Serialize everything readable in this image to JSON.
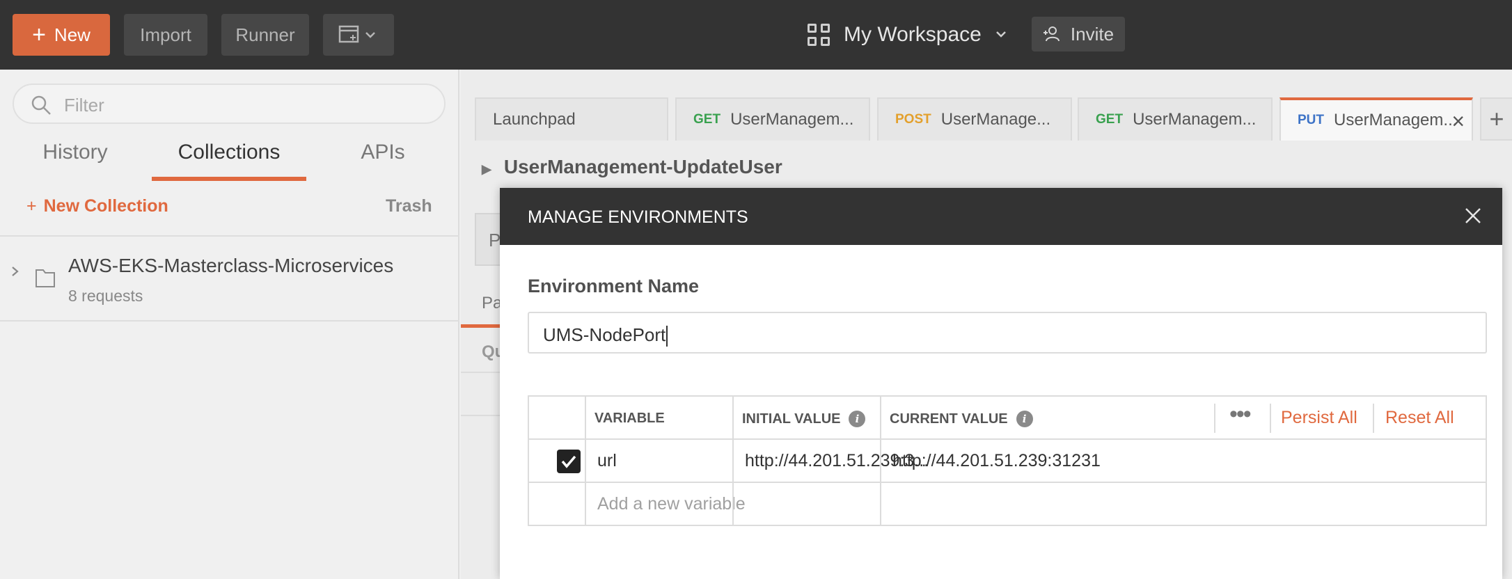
{
  "topbar": {
    "new_label": "New",
    "import_label": "Import",
    "runner_label": "Runner",
    "workspace_label": "My Workspace",
    "invite_label": "Invite"
  },
  "sidebar": {
    "filter_placeholder": "Filter",
    "tabs": [
      "History",
      "Collections",
      "APIs"
    ],
    "new_collection_label": "New Collection",
    "trash_label": "Trash",
    "collection": {
      "name": "AWS-EKS-Masterclass-Microservices",
      "count": "8 requests"
    }
  },
  "request_tabs": [
    {
      "method": "",
      "label": "Launchpad"
    },
    {
      "method": "GET",
      "label": "UserManagem..."
    },
    {
      "method": "POST",
      "label": "UserManage..."
    },
    {
      "method": "GET",
      "label": "UserManagem..."
    },
    {
      "method": "PUT",
      "label": "UserManagem..."
    }
  ],
  "request_title": "UserManagement-UpdateUser",
  "background_fragments": {
    "f1": "P",
    "f2": "Pa",
    "f3": "Qu"
  },
  "modal": {
    "title": "MANAGE ENVIRONMENTS",
    "env_name_label": "Environment Name",
    "env_name_value": "UMS-NodePort",
    "table": {
      "headers": {
        "variable": "VARIABLE",
        "initial": "INITIAL VALUE",
        "current": "CURRENT VALUE"
      },
      "persist_all": "Persist All",
      "reset_all": "Reset All",
      "rows": [
        {
          "checked": true,
          "variable": "url",
          "initial": "http://44.201.51.239:3...",
          "current": "http://44.201.51.239:31231"
        }
      ],
      "add_placeholder": "Add a new variable"
    }
  },
  "colors": {
    "accent": "#e0693f",
    "dark": "#333333"
  }
}
